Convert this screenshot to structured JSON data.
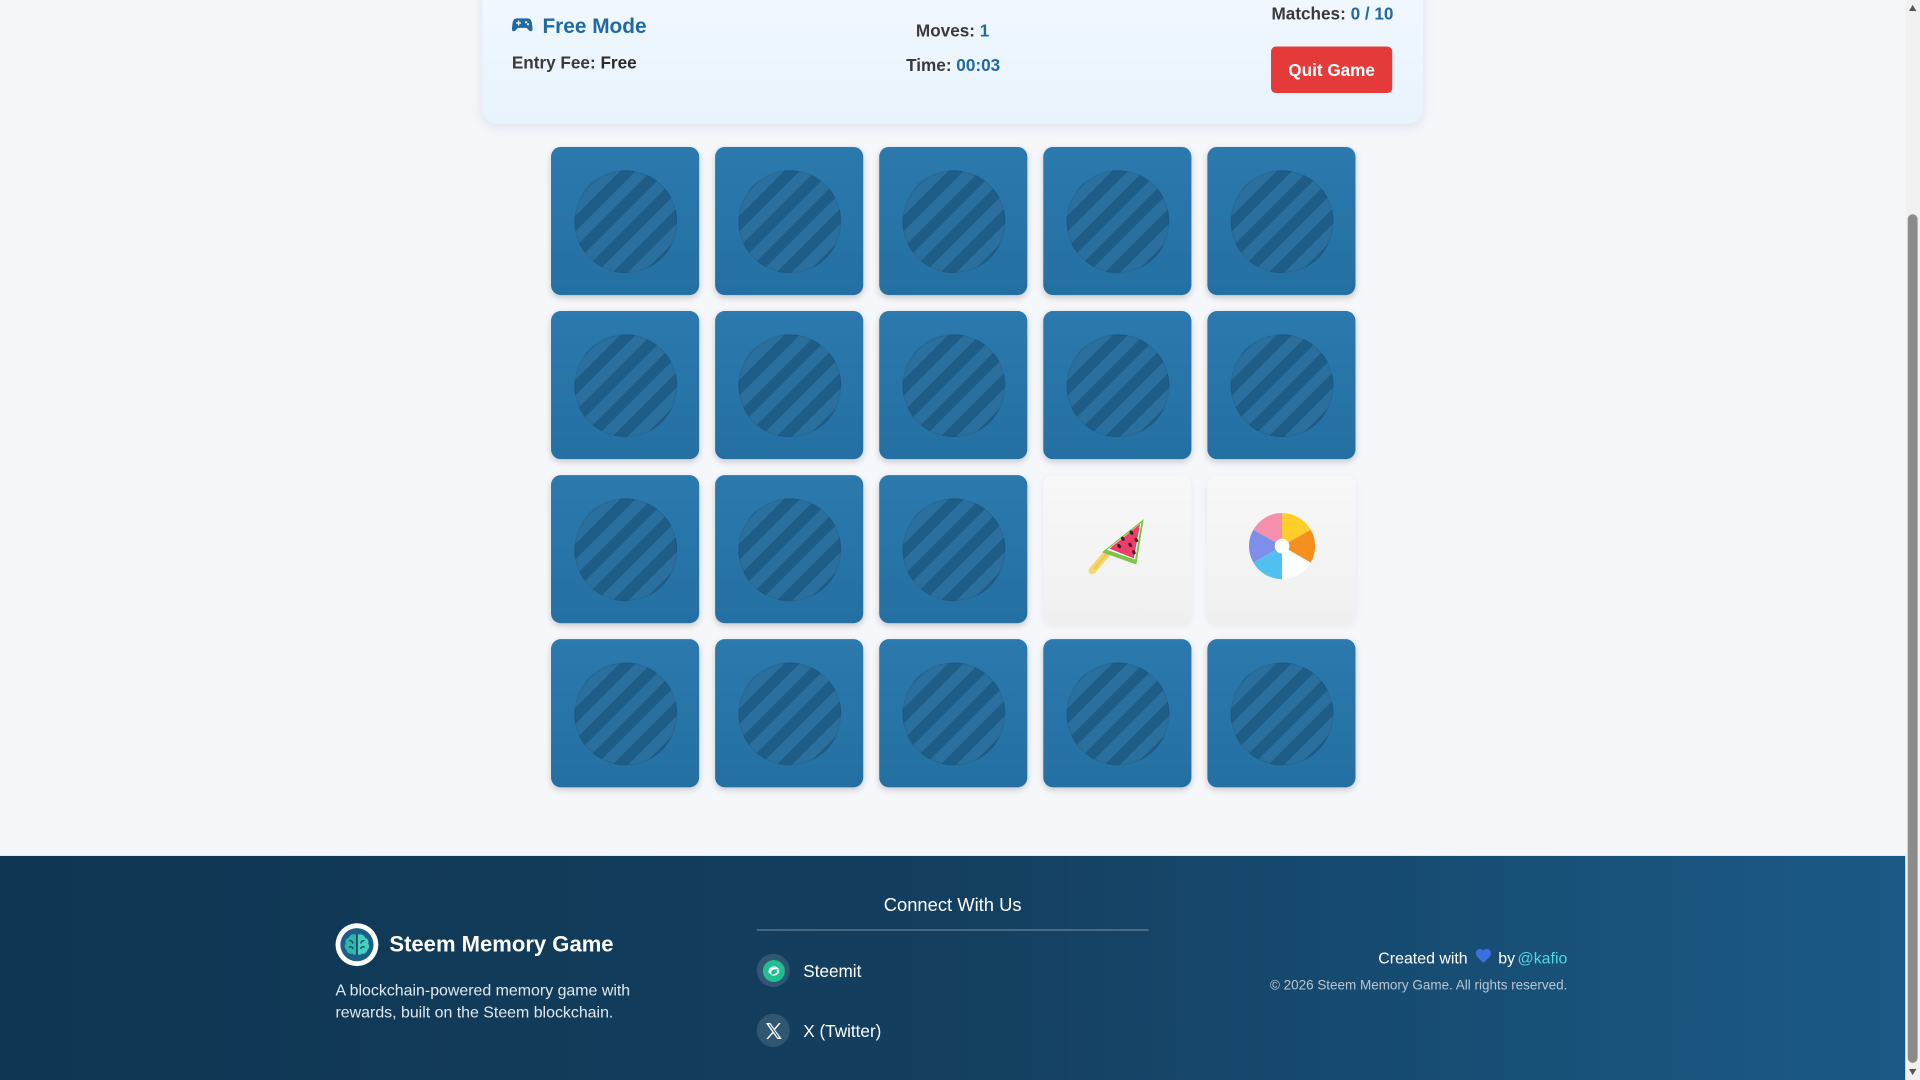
{
  "header": {
    "mode_icon": "gamepad-icon",
    "mode_title": "Free Mode",
    "entry_fee_label": "Entry Fee:",
    "entry_fee_value": "Free",
    "moves_label": "Moves:",
    "moves_value": "1",
    "time_label": "Time:",
    "time_value": "00:03",
    "matches_label": "Matches:",
    "matches_value": "0 / 10",
    "quit_label": "Quit Game"
  },
  "board": {
    "columns": 5,
    "rows": 4,
    "cards": [
      {
        "state": "hidden"
      },
      {
        "state": "hidden"
      },
      {
        "state": "hidden"
      },
      {
        "state": "hidden"
      },
      {
        "state": "hidden"
      },
      {
        "state": "hidden"
      },
      {
        "state": "hidden"
      },
      {
        "state": "hidden"
      },
      {
        "state": "hidden"
      },
      {
        "state": "hidden"
      },
      {
        "state": "hidden"
      },
      {
        "state": "hidden"
      },
      {
        "state": "hidden"
      },
      {
        "state": "revealed",
        "icon": "watermelon-popsicle-icon"
      },
      {
        "state": "revealed",
        "icon": "beach-ball-icon"
      },
      {
        "state": "hidden"
      },
      {
        "state": "hidden"
      },
      {
        "state": "hidden"
      },
      {
        "state": "hidden"
      },
      {
        "state": "hidden"
      }
    ]
  },
  "footer": {
    "brand_name": "Steem Memory Game",
    "brand_logo_icon": "brain-icon",
    "brand_desc": "A blockchain-powered memory game with rewards, built on the Steem blockchain.",
    "connect_title": "Connect With Us",
    "socials": [
      {
        "label": "Steemit",
        "icon": "steemit-icon"
      },
      {
        "label": "X (Twitter)",
        "icon": "x-twitter-icon"
      }
    ],
    "credit_prefix": "Created with",
    "credit_by": "by",
    "credit_author": "@kafio",
    "copyright": "© 2026 Steem Memory Game. All rights reserved."
  },
  "colors": {
    "accent": "#1f6aa5",
    "card_back": "#2774a8",
    "quit_button": "#e53a3a",
    "footer_bg": "#143f60",
    "author_link": "#4fd7e0"
  }
}
